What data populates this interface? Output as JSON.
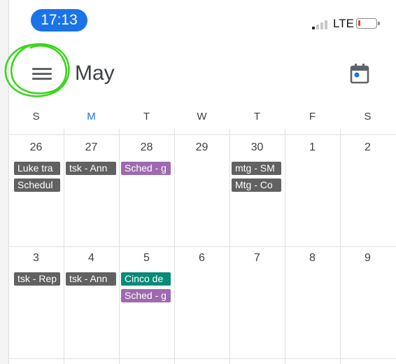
{
  "status_bar": {
    "time": "17:13",
    "network": "LTE"
  },
  "header": {
    "title": "May"
  },
  "weekdays": [
    "S",
    "M",
    "T",
    "W",
    "T",
    "F",
    "S"
  ],
  "weeks": [
    {
      "days": [
        "26",
        "27",
        "28",
        "29",
        "30",
        "1",
        "2"
      ]
    },
    {
      "days": [
        "3",
        "4",
        "5",
        "6",
        "7",
        "8",
        "9"
      ]
    }
  ],
  "events": [
    {
      "week": 0,
      "day": 0,
      "row": 0,
      "title": "Luke tra",
      "color": "#616161"
    },
    {
      "week": 0,
      "day": 0,
      "row": 1,
      "title": "Schedul",
      "color": "#616161"
    },
    {
      "week": 0,
      "day": 1,
      "row": 0,
      "title": "tsk - Ann",
      "color": "#616161"
    },
    {
      "week": 0,
      "day": 2,
      "row": 0,
      "title": "Sched - g",
      "color": "#9e69af"
    },
    {
      "week": 0,
      "day": 4,
      "row": 0,
      "title": "mtg - SM",
      "color": "#616161"
    },
    {
      "week": 0,
      "day": 4,
      "row": 1,
      "title": "Mtg - Co",
      "color": "#616161"
    },
    {
      "week": 1,
      "day": 0,
      "row": 0,
      "title": "tsk - Rep",
      "color": "#616161"
    },
    {
      "week": 1,
      "day": 1,
      "row": 0,
      "title": "tsk - Ann",
      "color": "#616161"
    },
    {
      "week": 1,
      "day": 2,
      "row": 0,
      "title": "Cinco de",
      "color": "#0b8a78"
    },
    {
      "week": 1,
      "day": 2,
      "row": 1,
      "title": "Sched - g",
      "color": "#9e69af"
    }
  ],
  "colors": {
    "accent": "#1a73e8",
    "annotation": "#39d61c"
  },
  "icons": {
    "menu": "hamburger-menu-icon",
    "today": "calendar-today-icon"
  }
}
